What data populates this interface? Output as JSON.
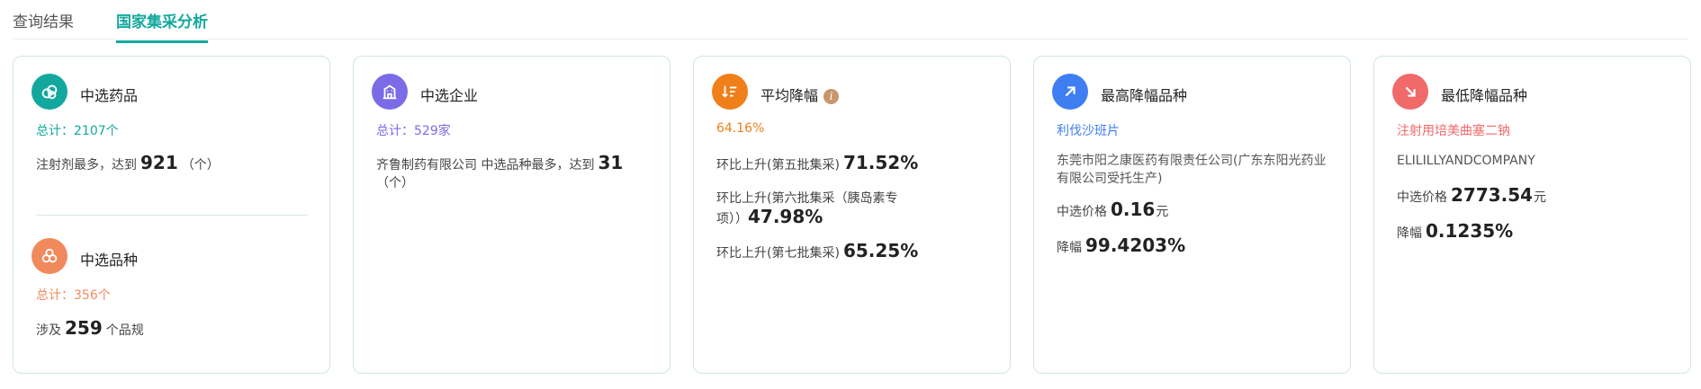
{
  "tabs": [
    {
      "label": "查询结果"
    },
    {
      "label": "国家集采分析"
    }
  ],
  "colors": {
    "teal": "#13a89e",
    "purple": "#7b6be6",
    "orange": "#f07f1a",
    "blue": "#3f7ef2",
    "red": "#f06a6a",
    "salmon": "#f08a5d"
  },
  "cards": {
    "drugs": {
      "title": "中选药品",
      "icon": "capsules-icon",
      "total": "总计：2107个",
      "detail_prefix": "注射剂最多，达到",
      "detail_value": "921",
      "detail_suffix": "（个）"
    },
    "varieties": {
      "title": "中选品种",
      "icon": "flower-icon",
      "total": "总计：356个",
      "detail_prefix": "涉及",
      "detail_value": "259",
      "detail_suffix": "个品规"
    },
    "companies": {
      "title": "中选企业",
      "icon": "building-icon",
      "total": "总计：529家",
      "detail_prefix": "齐鲁制药有限公司 中选品种最多，达到",
      "detail_value": "31",
      "detail_suffix": "（个）"
    },
    "avg_drop": {
      "title": "平均降幅",
      "icon": "list-down-icon",
      "info_icon": "info-icon",
      "value": "64.16%",
      "rows": [
        {
          "label": "环比上升(第五批集采)",
          "value": "71.52%"
        },
        {
          "label_line1": "环比上升(第六批集采（胰岛素专",
          "label_line2": "项））",
          "value": "47.98%"
        },
        {
          "label": "环比上升(第七批集采)",
          "value": "65.25%"
        }
      ]
    },
    "max_drop": {
      "title": "最高降幅品种",
      "icon": "arrow-up-right-icon",
      "drug": "利伐沙班片",
      "company": "东莞市阳之康医药有限责任公司(广东东阳光药业有限公司受托生产)",
      "price_label": "中选价格",
      "price_value": "0.16",
      "price_unit": "元",
      "drop_label": "降幅",
      "drop_value": "99.4203%"
    },
    "min_drop": {
      "title": "最低降幅品种",
      "icon": "arrow-down-right-icon",
      "drug": "注射用培美曲塞二钠",
      "company": "ELILILLYANDCOMPANY",
      "price_label": "中选价格",
      "price_value": "2773.54",
      "price_unit": "元",
      "drop_label": "降幅",
      "drop_value": "0.1235%"
    }
  }
}
